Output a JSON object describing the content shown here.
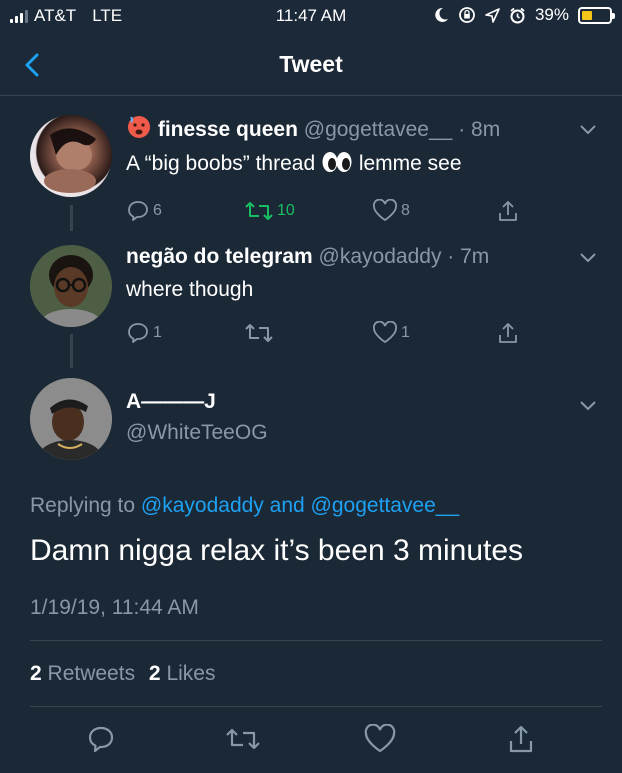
{
  "status_bar": {
    "carrier": "AT&T",
    "network": "LTE",
    "time": "11:47 AM",
    "battery_percent": "39%",
    "battery_level": 0.39,
    "icons": [
      "moon-icon",
      "rotation-lock-icon",
      "location-icon",
      "alarm-icon"
    ]
  },
  "nav": {
    "title": "Tweet"
  },
  "replies": [
    {
      "name": "finesse queen",
      "handle": "@gogettavee__",
      "time": "· 8m",
      "text_before": "A “big boobs” thread",
      "text_after": "lemme see",
      "reply_count": "6",
      "retweet_count": "10",
      "like_count": "8"
    },
    {
      "name": "negão do telegram",
      "handle": "@kayodaddy",
      "time": "· 7m",
      "text": "where though",
      "reply_count": "1",
      "like_count": "1"
    }
  ],
  "main_tweet": {
    "name": "A———J",
    "handle": "@WhiteTeeOG",
    "replying_prefix": "Replying to",
    "replying_user1": "@kayodaddy",
    "replying_and": "and",
    "replying_user2": "@gogettavee__",
    "text": "Damn nigga relax it’s been 3 minutes",
    "timestamp": "1/19/19, 11:44 AM",
    "retweets_count": "2",
    "retweets_label": "Retweets",
    "likes_count": "2",
    "likes_label": "Likes"
  },
  "colors": {
    "background": "#1b2836",
    "accent": "#1da1f2",
    "secondary_text": "#8899a6",
    "retweet_active": "#17bf63",
    "divider": "#38444d"
  }
}
